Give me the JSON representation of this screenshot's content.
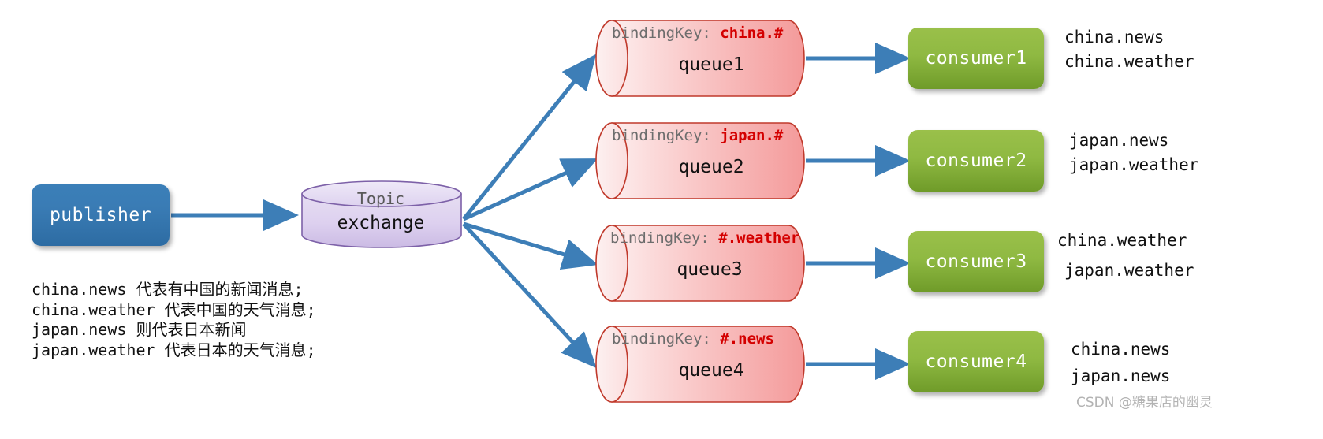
{
  "diagram": {
    "title": "RabbitMQ Topic Exchange routing diagram",
    "publisher": {
      "label": "publisher"
    },
    "exchange": {
      "type_label": "Topic",
      "label": "exchange"
    },
    "queues": [
      {
        "binding_prefix": "bindingKey: ",
        "binding_key": "china.#",
        "name": "queue1"
      },
      {
        "binding_prefix": "bindingKey: ",
        "binding_key": "japan.#",
        "name": "queue2"
      },
      {
        "binding_prefix": "bindingKey: ",
        "binding_key": "#.weather",
        "name": "queue3"
      },
      {
        "binding_prefix": "bindingKey: ",
        "binding_key": "#.news",
        "name": "queue4"
      }
    ],
    "consumers": [
      {
        "label": "consumer1",
        "routing_keys": [
          "china.news",
          "china.weather"
        ]
      },
      {
        "label": "consumer2",
        "routing_keys": [
          "japan.news",
          "japan.weather"
        ]
      },
      {
        "label": "consumer3",
        "routing_keys": [
          "china.weather",
          "japan.weather"
        ]
      },
      {
        "label": "consumer4",
        "routing_keys": [
          "china.news",
          "japan.news"
        ]
      }
    ],
    "legend": [
      "china.news 代表有中国的新闻消息;",
      "china.weather 代表中国的天气消息;",
      "japan.news 则代表日本新闻",
      "japan.weather 代表日本的天气消息;"
    ],
    "watermark": "CSDN @糖果店的幽灵",
    "colors": {
      "publisher_fill": "#3a7cb5",
      "exchange_fill": "#d9cdeb",
      "exchange_stroke": "#7d61a8",
      "queue_fill": "#f4b3b3",
      "queue_stroke": "#c0392b",
      "consumer_fill": "#8fb942",
      "arrow": "#3d7eb7",
      "binding_key": "#d40000",
      "binding_label": "#6d6d6d"
    }
  }
}
